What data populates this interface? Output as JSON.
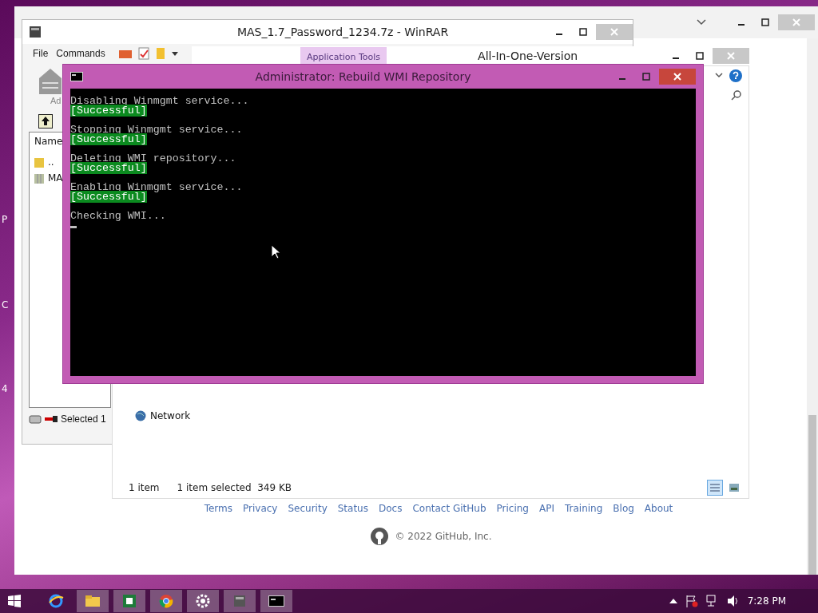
{
  "desktop_labels": [
    "P",
    "C",
    "4"
  ],
  "browser": {
    "footer_links": [
      "Terms",
      "Privacy",
      "Security",
      "Status",
      "Docs",
      "Contact GitHub",
      "Pricing",
      "API",
      "Training",
      "Blog",
      "About"
    ],
    "copyright": "© 2022 GitHub, Inc."
  },
  "explorer": {
    "ribbon_tab": "Application Tools",
    "title": "All-In-One-Version",
    "nav_items": [
      "Network"
    ],
    "status": [
      "1 item",
      "1 item selected  349 KB"
    ],
    "views": [
      {
        "kind": "details",
        "selected": true
      },
      {
        "kind": "icons",
        "selected": false
      }
    ]
  },
  "winrar": {
    "title": "MAS_1.7_Password_1234.7z - WinRAR",
    "menu": [
      "File",
      "Commands"
    ],
    "toolbar_label": "Ad",
    "column": "Name",
    "rows": [
      {
        "kind": "up",
        "name": ".."
      },
      {
        "kind": "archive",
        "name": "MA"
      }
    ],
    "status": "Selected 1"
  },
  "console": {
    "title": "Administrator:  Rebuild WMI Repository",
    "lines": [
      {
        "kind": "plain",
        "text": "Disabling Winmgmt service..."
      },
      {
        "kind": "success",
        "text": "[Successful]"
      },
      {
        "kind": "plain",
        "text": "Stopping Winmgmt service..."
      },
      {
        "kind": "success",
        "text": "[Successful]"
      },
      {
        "kind": "plain",
        "text": "Deleting WMI repository..."
      },
      {
        "kind": "success",
        "text": "[Successful]"
      },
      {
        "kind": "plain",
        "text": "Enabling Winmgmt service..."
      },
      {
        "kind": "success",
        "text": "[Successful]"
      },
      {
        "kind": "plain",
        "text": "Checking WMI..."
      }
    ]
  },
  "taskbar": {
    "apps": [
      {
        "kind": "ie",
        "active": false
      },
      {
        "kind": "folder",
        "active": true
      },
      {
        "kind": "sheet",
        "active": true
      },
      {
        "kind": "chrome",
        "active": true
      },
      {
        "kind": "gear",
        "active": true
      },
      {
        "kind": "rar",
        "active": true
      },
      {
        "kind": "console",
        "active": true
      }
    ],
    "clock": "7:28 PM"
  }
}
